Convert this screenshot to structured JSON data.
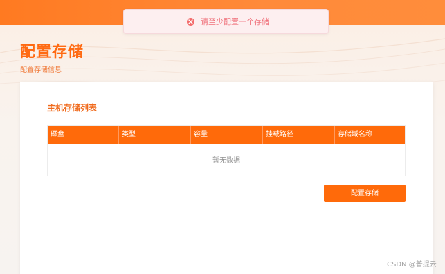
{
  "toast": {
    "message": "请至少配置一个存储",
    "icon": "error-circle-icon",
    "color": "#f36c6c"
  },
  "header": {
    "title": "配置存储",
    "subtitle": "配置存储信息"
  },
  "card": {
    "title": "主机存储列表",
    "table": {
      "columns": [
        "磁盘",
        "类型",
        "容量",
        "挂载路径",
        "存储域名称"
      ],
      "rows": [],
      "empty_text": "暂无数据"
    },
    "config_button_label": "配置存储"
  },
  "watermark": "CSDN @普提云",
  "colors": {
    "accent": "#ff6a0a",
    "header_band": "#ff7a21"
  }
}
